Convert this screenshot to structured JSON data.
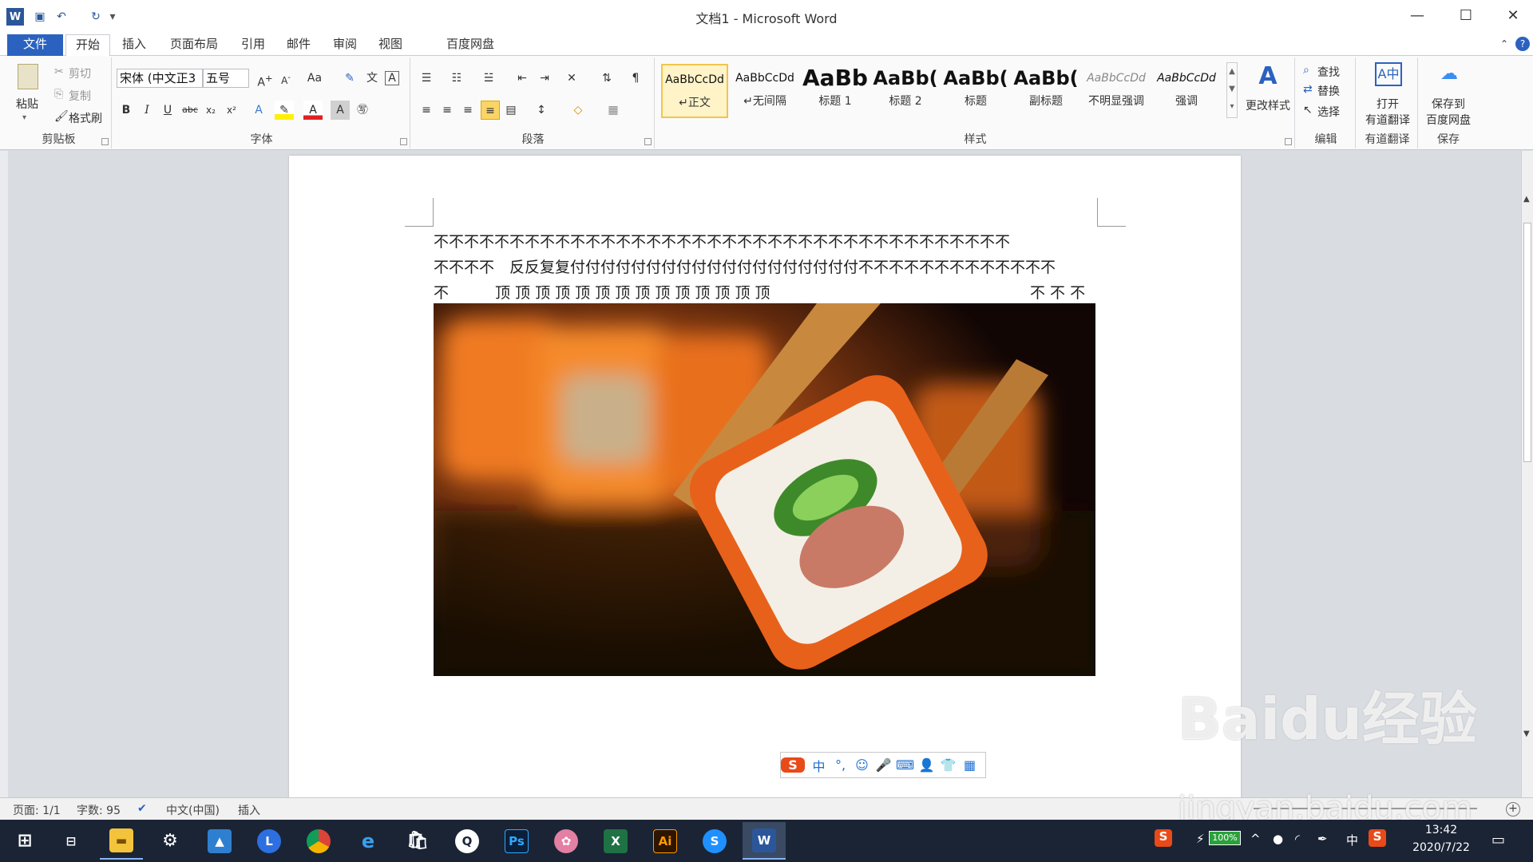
{
  "window": {
    "title": "文档1 - Microsoft Word",
    "minimize": "—",
    "maximize": "☐",
    "close": "✕"
  },
  "qat": {
    "undo": "↶",
    "redo": "↻",
    "more": "▾"
  },
  "tabs": [
    "文件",
    "开始",
    "插入",
    "页面布局",
    "引用",
    "邮件",
    "审阅",
    "视图",
    "百度网盘"
  ],
  "clipboard": {
    "paste": "粘贴",
    "cut": "剪切",
    "copy": "复制",
    "format_painter": "格式刷",
    "label": "剪贴板"
  },
  "font": {
    "name": "宋体 (中文正3",
    "size": "五号",
    "label": "字体"
  },
  "paragraph": {
    "label": "段落"
  },
  "styles": {
    "items": [
      {
        "preview": "AaBbCcDd",
        "name": "↵正文"
      },
      {
        "preview": "AaBbCcDd",
        "name": "↵无间隔"
      },
      {
        "preview": "AaBb",
        "name": "标题 1"
      },
      {
        "preview": "AaBb(",
        "name": "标题 2"
      },
      {
        "preview": "AaBb(",
        "name": "标题"
      },
      {
        "preview": "AaBb(",
        "name": "副标题"
      },
      {
        "preview": "AaBbCcDd",
        "name": "不明显强调"
      },
      {
        "preview": "AaBbCcDd",
        "name": "强调"
      }
    ],
    "change": "更改样式",
    "label": "样式"
  },
  "editing": {
    "find": "查找",
    "replace": "替换",
    "select": "选择",
    "label": "编辑"
  },
  "youdao": {
    "open": "打开",
    "name": "有道翻译",
    "label": "有道翻译"
  },
  "save": {
    "line1": "保存到",
    "line2": "百度网盘",
    "label": "保存"
  },
  "document": {
    "line1": "不不不不不不不不不不不不不不不不不不不不不不不不不不不不不不不不不不不不不不",
    "line2": "不不不不　反反复复付付付付付付付付付付付付付付付付付付付不不不不不不不不不不不不不",
    "line3_left": "不",
    "line3_mid": "顶 顶 顶 顶 顶 顶 顶 顶 顶 顶 顶 顶 顶 顶",
    "line3_right": "不 不 不"
  },
  "status": {
    "page": "页面: 1/1",
    "words": "字数: 95",
    "lang": "中文(中国)",
    "mode": "插入"
  },
  "ime": [
    "中",
    "°,",
    "☺",
    "🎤",
    "⌨",
    "👤",
    "👕",
    "▦"
  ],
  "clock": {
    "time": "13:42",
    "date": "2020/7/22"
  },
  "tray": {
    "battery": "100%",
    "lang": "中"
  },
  "watermark": {
    "line1": "Baidu经验",
    "line2": "jingyan.baidu.com"
  },
  "colors": {
    "accent": "#2b579a",
    "file_tab": "#2b62c0",
    "taskbar": "#1b2435"
  }
}
